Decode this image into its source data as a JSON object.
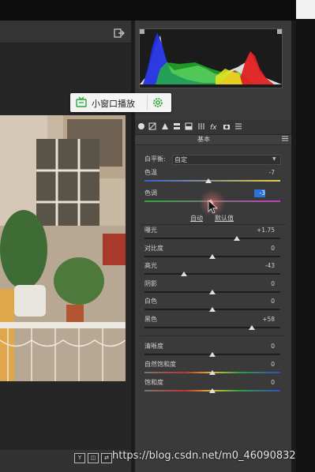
{
  "popup": {
    "label": "小窗口播放"
  },
  "panel": {
    "section_title": "基本",
    "white_balance": {
      "label": "白平衡:",
      "value": "自定"
    },
    "sliders": [
      {
        "label": "色温",
        "value": "-7",
        "level": 0.47
      },
      {
        "label": "色调",
        "value": "-3",
        "level": 0.49
      },
      {
        "label": "曝光",
        "value": "+1.75",
        "level": 0.68
      },
      {
        "label": "对比度",
        "value": "0",
        "level": 0.5
      },
      {
        "label": "高光",
        "value": "-43",
        "level": 0.29
      },
      {
        "label": "阴影",
        "value": "0",
        "level": 0.5
      },
      {
        "label": "白色",
        "value": "0",
        "level": 0.5
      },
      {
        "label": "黑色",
        "value": "+58",
        "level": 0.79
      },
      {
        "label": "清晰度",
        "value": "0",
        "level": 0.5
      },
      {
        "label": "自然饱和度",
        "value": "0",
        "level": 0.5
      },
      {
        "label": "饱和度",
        "value": "0",
        "level": 0.5
      }
    ],
    "auto_label": "自动",
    "default_label": "默认值"
  },
  "watermark": "https://blog.csdn.net/m0_46090832",
  "footer_buttons": [
    "Y",
    "",
    ""
  ],
  "colors": {
    "accent_green": "#22aa33",
    "value_highlight": "#2b74d6"
  },
  "icons": [
    "exit-icon",
    "tv-icon",
    "gear-icon",
    "menu-icon",
    "cursor-icon"
  ]
}
